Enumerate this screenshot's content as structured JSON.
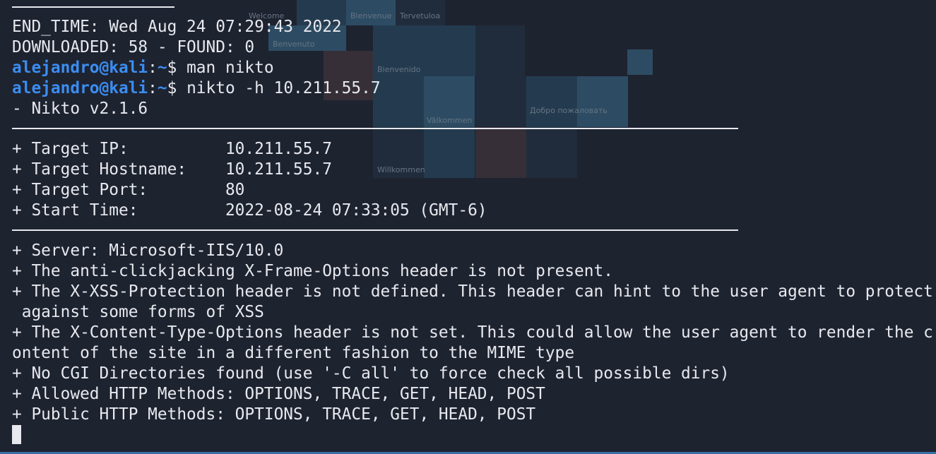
{
  "terminal": {
    "top_rule_label": "",
    "end_time": "END_TIME: Wed Aug 24 07:29:43 2022",
    "downloaded": "DOWNLOADED: 58 - FOUND: 0",
    "prompt1": {
      "user": "alejandro@kali",
      "sep": ":",
      "path": "~",
      "dollar": "$ ",
      "command": "man nikto"
    },
    "prompt2": {
      "user": "alejandro@kali",
      "sep": ":",
      "path": "~",
      "dollar": "$ ",
      "command": "nikto -h 10.211.55.7"
    },
    "version": "- Nikto v2.1.6",
    "target_ip": "+ Target IP:          10.211.55.7",
    "target_hostname": "+ Target Hostname:    10.211.55.7",
    "target_port": "+ Target Port:        80",
    "start_time": "+ Start Time:         2022-08-24 07:33:05 (GMT-6)",
    "server": "+ Server: Microsoft-IIS/10.0",
    "clickjacking": "+ The anti-clickjacking X-Frame-Options header is not present.",
    "xss_1": "+ The X-XSS-Protection header is not defined. This header can hint to the user agent to protect",
    "xss_2": " against some forms of XSS",
    "content_type_1": "+ The X-Content-Type-Options header is not set. This could allow the user agent to render the c",
    "content_type_2": "ontent of the site in a different fashion to the MIME type",
    "cgi": "+ No CGI Directories found (use '-C all' to force check all possible dirs)",
    "allowed_methods": "+ Allowed HTTP Methods: OPTIONS, TRACE, GET, HEAD, POST",
    "public_methods": "+ Public HTTP Methods: OPTIONS, TRACE, GET, HEAD, POST"
  },
  "background_words": [
    "Welcome",
    "Bienvenue",
    "Tervetuloa",
    "Benvenuto",
    "Bienvenido",
    "Välkommen",
    "Добро пожаловать",
    "Willkommen"
  ],
  "colors": {
    "background": "#1e2330",
    "text": "#e7e9ee",
    "prompt": "#3b8df0"
  }
}
